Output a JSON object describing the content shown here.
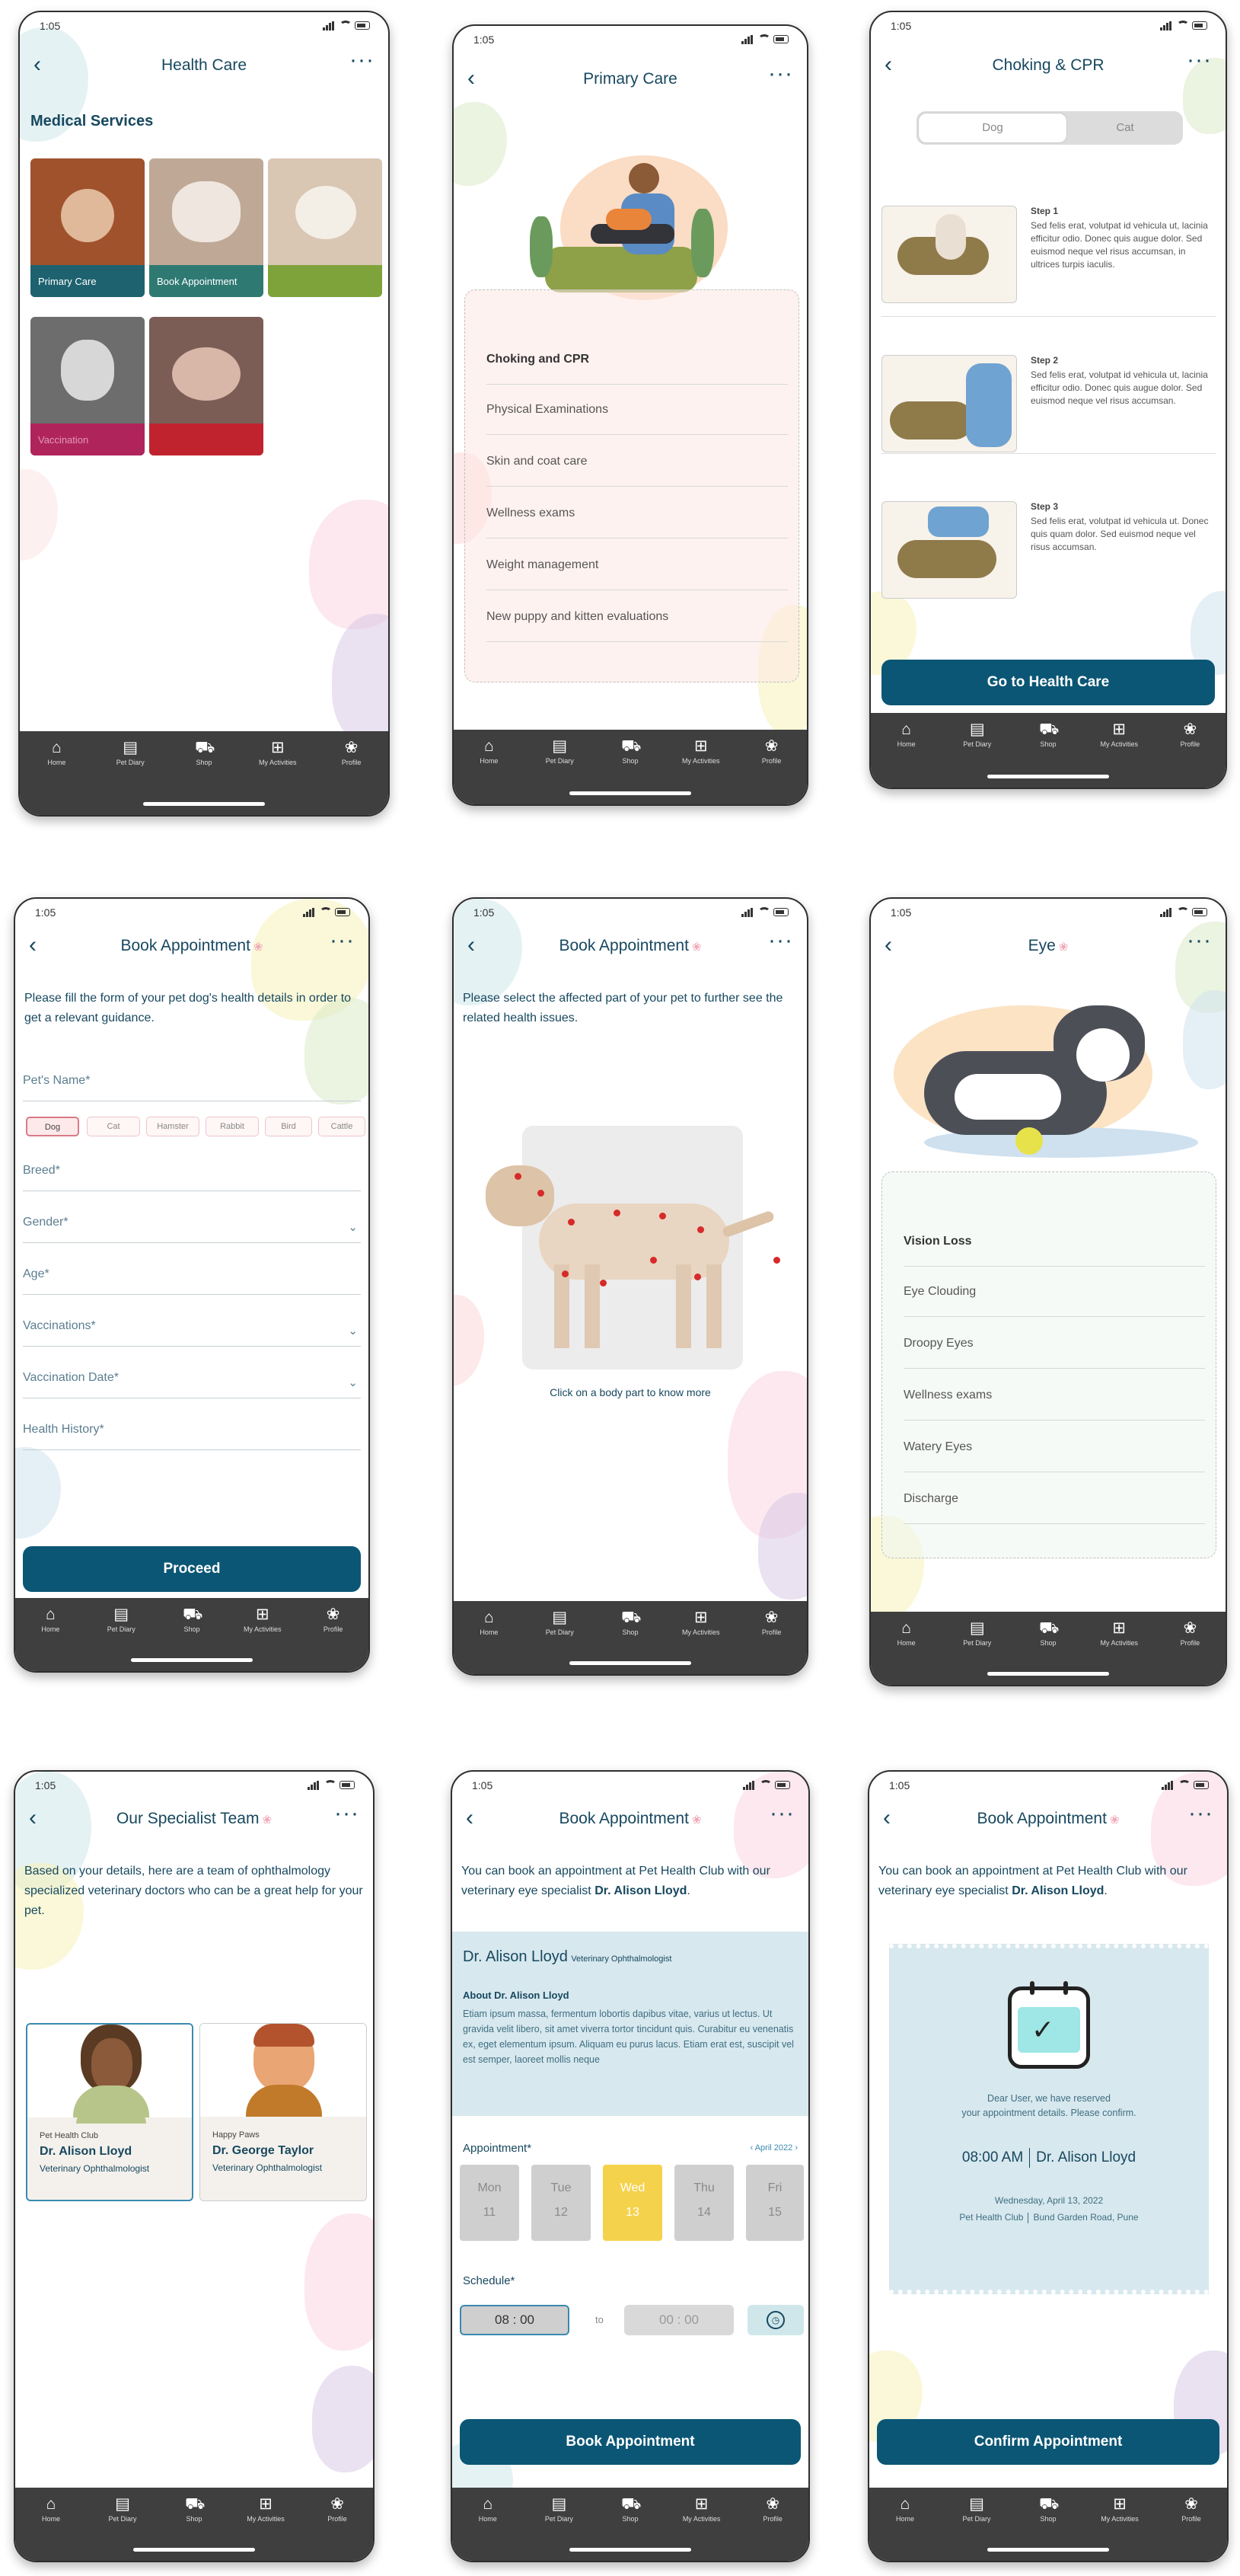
{
  "status": {
    "time": "1:05"
  },
  "nav": {
    "items": [
      {
        "label": "Home",
        "icon": "home-icon",
        "glyph": "⌂"
      },
      {
        "label": "Pet Diary",
        "icon": "diary-icon",
        "glyph": "▤"
      },
      {
        "label": "Shop",
        "icon": "cart-icon",
        "glyph": "⛟"
      },
      {
        "label": "My Activities",
        "icon": "grid-icon",
        "glyph": "⊞"
      },
      {
        "label": "Profile",
        "icon": "paw-icon",
        "glyph": "❀"
      }
    ]
  },
  "s1": {
    "title": "Health Care",
    "section": "Medical Services",
    "tiles": [
      {
        "label": "Primary Care",
        "bg": "#a0522d",
        "bar": "#1e6270"
      },
      {
        "label": "Book Appointment",
        "bg": "#bfa996",
        "bar": "#2e7a73"
      },
      {
        "label": "",
        "bg": "#d9c6b3",
        "bar": "#7ea33b"
      },
      {
        "label": "Vaccination",
        "bg": "#6d6d6d",
        "bar": "#b0245c"
      },
      {
        "label": "",
        "bg": "#7b5d55",
        "bar": "#c0232e"
      }
    ]
  },
  "s2": {
    "title": "Primary Care",
    "items": [
      "Choking and CPR",
      "Physical Examinations",
      "Skin and coat care",
      "Wellness exams",
      "Weight management",
      "New puppy and kitten evaluations"
    ]
  },
  "s3": {
    "title": "Choking & CPR",
    "toggle": [
      "Dog",
      "Cat"
    ],
    "steps": [
      {
        "title": "Step 1",
        "text": "Sed felis erat, volutpat id vehicula ut, lacinia efficitur odio. Donec quis augue dolor. Sed euismod neque vel risus accumsan, in ultrices turpis iaculis."
      },
      {
        "title": "Step 2",
        "text": "Sed felis erat, volutpat id vehicula ut, lacinia efficitur odio. Donec quis augue dolor. Sed euismod neque vel risus accumsan."
      },
      {
        "title": "Step 3",
        "text": "Sed felis erat, volutpat id vehicula ut. Donec quis quam dolor. Sed euismod neque vel risus accumsan."
      }
    ],
    "button": "Go to Health Care"
  },
  "s4": {
    "title": "Book Appointment",
    "intro": "Please fill the form of your pet dog's health details in order to get a relevant guidance.",
    "pet_name": "Pet's Name*",
    "chips": [
      "Dog",
      "Cat",
      "Hamster",
      "Rabbit",
      "Bird",
      "Cattle"
    ],
    "fields": [
      "Breed*",
      "Gender*",
      "Age*",
      "Vaccinations*",
      "Vaccination Date*",
      "Health History*"
    ],
    "button": "Proceed"
  },
  "s5": {
    "title": "Book Appointment",
    "intro": "Please select the affected part of your pet to further see the related health issues.",
    "caption": "Click on a body part to know more"
  },
  "s6": {
    "title": "Eye",
    "items": [
      "Vision Loss",
      "Eye Clouding",
      "Droopy Eyes",
      "Wellness exams",
      "Watery Eyes",
      "Discharge"
    ]
  },
  "s7": {
    "title": "Our Specialist Team",
    "intro": "Based on your details, here are a team of ophthalmology specialized veterinary doctors who can be a great help for your pet.",
    "doctors": [
      {
        "clinic": "Pet Health Club",
        "name": "Dr. Alison Lloyd",
        "role": "Veterinary Ophthalmologist"
      },
      {
        "clinic": "Happy Paws",
        "name": "Dr. George Taylor",
        "role": "Veterinary Ophthalmologist"
      }
    ]
  },
  "s8": {
    "title": "Book Appointment",
    "intro": "You can book an appointment at Pet Health Club with our veterinary eye specialist ",
    "intro_bold": "Dr. Alison Lloyd",
    "doc_name": "Dr. Alison Lloyd",
    "doc_role": "Veterinary Ophthalmologist",
    "about_title": "About Dr. Alison Lloyd",
    "about": "Etiam ipsum massa, fermentum lobortis dapibus vitae, varius ut lectus. Ut gravida velit libero, sit amet viverra tortor tincidunt quis. Curabitur eu venenatis ex, eget elementum ipsum. Aliquam eu purus lacus. Etiam erat est, suscipit vel est semper, laoreet mollis neque",
    "appt_label": "Appointment*",
    "month": "April 2022",
    "days": [
      {
        "d": "Mon",
        "n": "11"
      },
      {
        "d": "Tue",
        "n": "12"
      },
      {
        "d": "Wed",
        "n": "13"
      },
      {
        "d": "Thu",
        "n": "14"
      },
      {
        "d": "Fri",
        "n": "15"
      }
    ],
    "schedule_label": "Schedule*",
    "from": "08 : 00",
    "to_label": "to",
    "to": "00 : 00",
    "button": "Book Appointment"
  },
  "s9": {
    "title": "Book Appointment",
    "intro": "You can book an appointment at Pet Health Club with our veterinary eye specialist ",
    "intro_bold": "Dr. Alison Lloyd",
    "ticket_msg1": "Dear User, we have reserved",
    "ticket_msg2": "your appointment details. Please confirm.",
    "time": "08:00 AM",
    "doctor": "Dr. Alison Lloyd",
    "date": "Wednesday, April 13, 2022",
    "clinic": "Pet Health Club",
    "address": "Bund Garden Road, Pune",
    "button": "Confirm Appointment"
  },
  "colors": {
    "primary": "#0b5675",
    "nav": "#3f3f3f",
    "accent_yellow": "#f5d24b"
  }
}
